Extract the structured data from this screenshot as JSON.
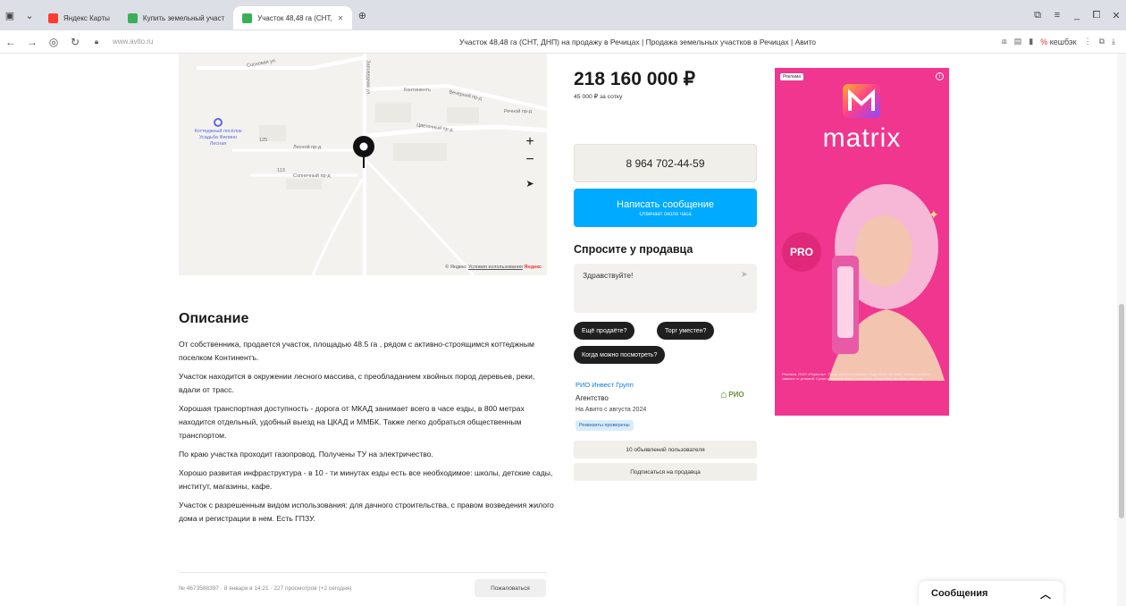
{
  "browser": {
    "tabs": [
      {
        "label": "Яндекс Карты",
        "active": false
      },
      {
        "label": "Купить земельный участ",
        "active": false
      },
      {
        "label": "Участок 48,48 га (СНТ,",
        "active": true
      }
    ],
    "url": "www.avito.ru",
    "page_title": "Участок 48,48 га (СНТ, ДНП) на продажу в Речицах | Продажа земельных участков в Речицах | Авито",
    "cashback_label": "кешбэк"
  },
  "map": {
    "streets": [
      "Сосновая ул.",
      "Заповедная ул.",
      "Континентъ",
      "Вечерний пр-д",
      "Речной пр-д",
      "Цветочный пр-д",
      "Лесной пр-д",
      "Солнечный пр-д",
      "125",
      "113"
    ],
    "poi": "Коттеджный посёлок Усадьба Филино Лесная",
    "zoom_in": "+",
    "zoom_out": "−",
    "attribution_prefix": "© Яндекс",
    "attribution_link": "Условия использования",
    "attribution_brand": "Яндекс"
  },
  "description": {
    "heading": "Описание",
    "paragraphs": [
      "От собственника, продается участок, площадью 48.5 га , рядом с активно-строящимся коттеджным поселком Континентъ.",
      "Участок находится в окружении лесного массива, с преобладанием хвойных пород деревьев, реки, вдали от трасс.",
      "Хорошая транспортная доступность - дорога от МКАД занимает всего в часе езды, в 800 метрах находится отдельный, удобный выезд на ЦКАД и ММБК. Также легко добраться общественным транспортом.",
      "По краю участка проходит газопровод. Получены ТУ на электричество.",
      "Хорошо развитая инфраструктура - в 10 - ти минутах езды есть все необходимое: школы, детские сады, институт, магазины, кафе.",
      "Участок с разрешенным видом использования: для дачного строительства, с правом возведения жилого дома и регистрации в нем. Есть ГПЗУ."
    ],
    "meta": "№ 4673588397 · 8 января в 14:21 · 227 просмотров (+2 сегодня)",
    "complain": "Пожаловаться"
  },
  "listing": {
    "price": "218 160 000 ₽",
    "price_per": "45 000 ₽ за сотку",
    "phone": "8 964 702-44-59",
    "message_btn": "Написать сообщение",
    "message_sub": "Отвечает около часа",
    "ask_heading": "Спросите у продавца",
    "ask_placeholder": "Здравствуйте!",
    "chips": [
      "Ещё продаёте?",
      "Торг уместен?",
      "Когда можно посмотреть?"
    ]
  },
  "seller": {
    "name": "РИО Инвест Групп",
    "type": "Агентство",
    "since": "На Авито с августа 2024",
    "verified": "Реквизиты проверены",
    "logo_text": "РИО",
    "ads_btn": "10 объявлений пользователя",
    "subscribe_btn": "Подписаться на продавца"
  },
  "ad": {
    "tag": "Реклама",
    "brand": "matrix",
    "badge": "PRO",
    "legal": "Реклама. ООО «Лореаль». Товар зарегистрирован. Подробнее на сайте. Выбор кэшбэка зависит от условий. Сроки и условия акции уточняйте. Подробнее на сайте matrix.ru"
  },
  "messages": {
    "label": "Сообщения"
  },
  "colors": {
    "primary_blue": "#00aaff",
    "ad_pink": "#f0368f",
    "chip_dark": "#1f1f1f"
  }
}
